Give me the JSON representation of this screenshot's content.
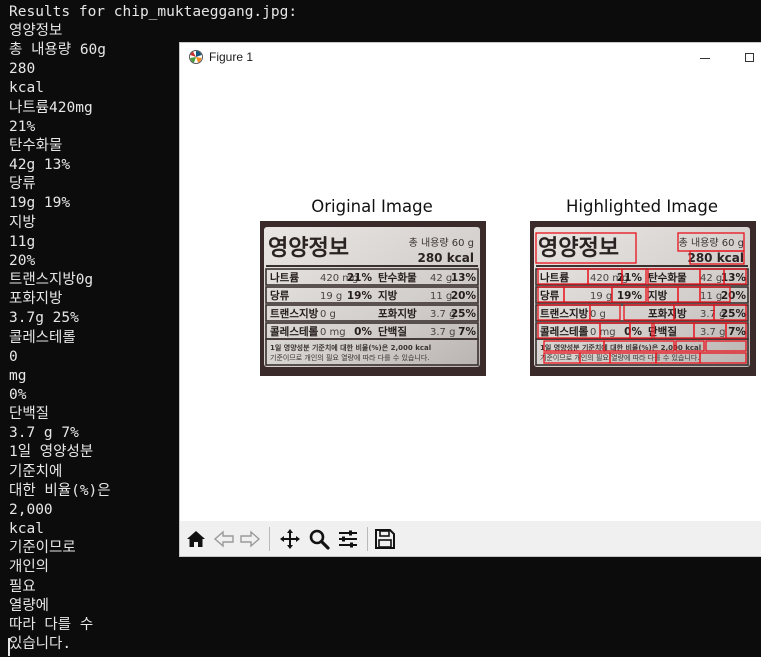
{
  "terminal": {
    "header": "Results for chip_muktaeggang.jpg:",
    "lines": [
      "영양정보",
      "총 내용량 60g",
      "280",
      "kcal",
      "나트륨420mg",
      "21%",
      "탄수화물",
      "42g 13%",
      "당류",
      "19g 19%",
      "지방",
      "11g",
      "20%",
      "트랜스지방0g",
      "포화지방",
      "3.7g 25%",
      "콜레스테롤",
      "0",
      "mg",
      "0%",
      "단백질",
      "3.7 g 7%",
      "1일 영양성분",
      "기준치에",
      "대한 비율(%)은",
      "2,000",
      "kcal",
      "기준이므로",
      "개인의",
      "필요",
      "열량에",
      "따라 다를 수",
      "있습니다."
    ]
  },
  "window": {
    "title": "Figure 1"
  },
  "figure": {
    "left_title": "Original Image",
    "right_title": "Highlighted Image",
    "label": {
      "heading": "영양정보",
      "total": "총 내용량 60 g",
      "kcal": "280 kcal",
      "row1a": "나트륨",
      "row1a_val": "420 mg",
      "row1a_pct": "21%",
      "row1b": "탄수화물",
      "row1b_val": "42 g",
      "row1b_pct": "13%",
      "row2a": "당류",
      "row2a_val": "19 g",
      "row2a_pct": "19%",
      "row2b": "지방",
      "row2b_val": "11 g",
      "row2b_pct": "20%",
      "row3a": "트랜스지방",
      "row3a_val": "0 g",
      "row3b": "포화지방",
      "row3b_val": "3.7 g",
      "row3b_pct": "25%",
      "row4a": "콜레스테롤",
      "row4a_val": "0 mg",
      "row4a_pct": "0%",
      "row4b": "단백질",
      "row4b_val": "3.7 g",
      "row4b_pct": "7%",
      "foot1": "1일 영양성분 기준치에 대한 비율(%)은 2,000 kcal",
      "foot2": "기준이므로 개인의 필요 열량에 따라 다를 수 있습니다."
    }
  },
  "toolbar": {
    "tools": [
      "home-icon",
      "back-icon",
      "forward-icon",
      "pan-icon",
      "zoom-icon",
      "configure-subplots-icon",
      "save-icon"
    ]
  },
  "colors": {
    "terminal_bg": "#0c0c0c",
    "terminal_text": "#e6e6e6",
    "label_bg": "#3a2a2a",
    "highlight": "#e8121b"
  }
}
